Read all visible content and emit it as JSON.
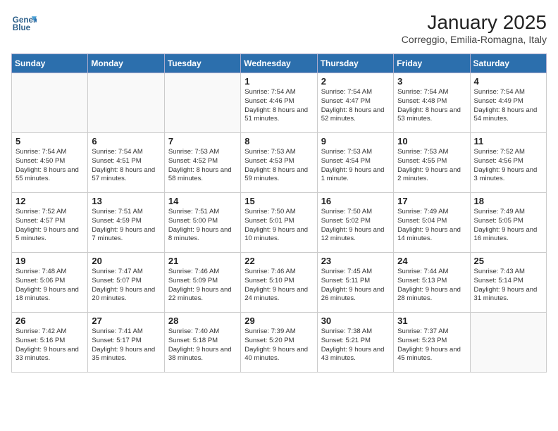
{
  "header": {
    "logo_line1": "General",
    "logo_line2": "Blue",
    "month_title": "January 2025",
    "location": "Correggio, Emilia-Romagna, Italy"
  },
  "weekdays": [
    "Sunday",
    "Monday",
    "Tuesday",
    "Wednesday",
    "Thursday",
    "Friday",
    "Saturday"
  ],
  "weeks": [
    [
      {
        "day": "",
        "sunrise": "",
        "sunset": "",
        "daylight": "",
        "empty": true
      },
      {
        "day": "",
        "sunrise": "",
        "sunset": "",
        "daylight": "",
        "empty": true
      },
      {
        "day": "",
        "sunrise": "",
        "sunset": "",
        "daylight": "",
        "empty": true
      },
      {
        "day": "1",
        "sunrise": "Sunrise: 7:54 AM",
        "sunset": "Sunset: 4:46 PM",
        "daylight": "Daylight: 8 hours and 51 minutes."
      },
      {
        "day": "2",
        "sunrise": "Sunrise: 7:54 AM",
        "sunset": "Sunset: 4:47 PM",
        "daylight": "Daylight: 8 hours and 52 minutes."
      },
      {
        "day": "3",
        "sunrise": "Sunrise: 7:54 AM",
        "sunset": "Sunset: 4:48 PM",
        "daylight": "Daylight: 8 hours and 53 minutes."
      },
      {
        "day": "4",
        "sunrise": "Sunrise: 7:54 AM",
        "sunset": "Sunset: 4:49 PM",
        "daylight": "Daylight: 8 hours and 54 minutes."
      }
    ],
    [
      {
        "day": "5",
        "sunrise": "Sunrise: 7:54 AM",
        "sunset": "Sunset: 4:50 PM",
        "daylight": "Daylight: 8 hours and 55 minutes."
      },
      {
        "day": "6",
        "sunrise": "Sunrise: 7:54 AM",
        "sunset": "Sunset: 4:51 PM",
        "daylight": "Daylight: 8 hours and 57 minutes."
      },
      {
        "day": "7",
        "sunrise": "Sunrise: 7:53 AM",
        "sunset": "Sunset: 4:52 PM",
        "daylight": "Daylight: 8 hours and 58 minutes."
      },
      {
        "day": "8",
        "sunrise": "Sunrise: 7:53 AM",
        "sunset": "Sunset: 4:53 PM",
        "daylight": "Daylight: 8 hours and 59 minutes."
      },
      {
        "day": "9",
        "sunrise": "Sunrise: 7:53 AM",
        "sunset": "Sunset: 4:54 PM",
        "daylight": "Daylight: 9 hours and 1 minute."
      },
      {
        "day": "10",
        "sunrise": "Sunrise: 7:53 AM",
        "sunset": "Sunset: 4:55 PM",
        "daylight": "Daylight: 9 hours and 2 minutes."
      },
      {
        "day": "11",
        "sunrise": "Sunrise: 7:52 AM",
        "sunset": "Sunset: 4:56 PM",
        "daylight": "Daylight: 9 hours and 3 minutes."
      }
    ],
    [
      {
        "day": "12",
        "sunrise": "Sunrise: 7:52 AM",
        "sunset": "Sunset: 4:57 PM",
        "daylight": "Daylight: 9 hours and 5 minutes."
      },
      {
        "day": "13",
        "sunrise": "Sunrise: 7:51 AM",
        "sunset": "Sunset: 4:59 PM",
        "daylight": "Daylight: 9 hours and 7 minutes."
      },
      {
        "day": "14",
        "sunrise": "Sunrise: 7:51 AM",
        "sunset": "Sunset: 5:00 PM",
        "daylight": "Daylight: 9 hours and 8 minutes."
      },
      {
        "day": "15",
        "sunrise": "Sunrise: 7:50 AM",
        "sunset": "Sunset: 5:01 PM",
        "daylight": "Daylight: 9 hours and 10 minutes."
      },
      {
        "day": "16",
        "sunrise": "Sunrise: 7:50 AM",
        "sunset": "Sunset: 5:02 PM",
        "daylight": "Daylight: 9 hours and 12 minutes."
      },
      {
        "day": "17",
        "sunrise": "Sunrise: 7:49 AM",
        "sunset": "Sunset: 5:04 PM",
        "daylight": "Daylight: 9 hours and 14 minutes."
      },
      {
        "day": "18",
        "sunrise": "Sunrise: 7:49 AM",
        "sunset": "Sunset: 5:05 PM",
        "daylight": "Daylight: 9 hours and 16 minutes."
      }
    ],
    [
      {
        "day": "19",
        "sunrise": "Sunrise: 7:48 AM",
        "sunset": "Sunset: 5:06 PM",
        "daylight": "Daylight: 9 hours and 18 minutes."
      },
      {
        "day": "20",
        "sunrise": "Sunrise: 7:47 AM",
        "sunset": "Sunset: 5:07 PM",
        "daylight": "Daylight: 9 hours and 20 minutes."
      },
      {
        "day": "21",
        "sunrise": "Sunrise: 7:46 AM",
        "sunset": "Sunset: 5:09 PM",
        "daylight": "Daylight: 9 hours and 22 minutes."
      },
      {
        "day": "22",
        "sunrise": "Sunrise: 7:46 AM",
        "sunset": "Sunset: 5:10 PM",
        "daylight": "Daylight: 9 hours and 24 minutes."
      },
      {
        "day": "23",
        "sunrise": "Sunrise: 7:45 AM",
        "sunset": "Sunset: 5:11 PM",
        "daylight": "Daylight: 9 hours and 26 minutes."
      },
      {
        "day": "24",
        "sunrise": "Sunrise: 7:44 AM",
        "sunset": "Sunset: 5:13 PM",
        "daylight": "Daylight: 9 hours and 28 minutes."
      },
      {
        "day": "25",
        "sunrise": "Sunrise: 7:43 AM",
        "sunset": "Sunset: 5:14 PM",
        "daylight": "Daylight: 9 hours and 31 minutes."
      }
    ],
    [
      {
        "day": "26",
        "sunrise": "Sunrise: 7:42 AM",
        "sunset": "Sunset: 5:16 PM",
        "daylight": "Daylight: 9 hours and 33 minutes."
      },
      {
        "day": "27",
        "sunrise": "Sunrise: 7:41 AM",
        "sunset": "Sunset: 5:17 PM",
        "daylight": "Daylight: 9 hours and 35 minutes."
      },
      {
        "day": "28",
        "sunrise": "Sunrise: 7:40 AM",
        "sunset": "Sunset: 5:18 PM",
        "daylight": "Daylight: 9 hours and 38 minutes."
      },
      {
        "day": "29",
        "sunrise": "Sunrise: 7:39 AM",
        "sunset": "Sunset: 5:20 PM",
        "daylight": "Daylight: 9 hours and 40 minutes."
      },
      {
        "day": "30",
        "sunrise": "Sunrise: 7:38 AM",
        "sunset": "Sunset: 5:21 PM",
        "daylight": "Daylight: 9 hours and 43 minutes."
      },
      {
        "day": "31",
        "sunrise": "Sunrise: 7:37 AM",
        "sunset": "Sunset: 5:23 PM",
        "daylight": "Daylight: 9 hours and 45 minutes."
      },
      {
        "day": "",
        "sunrise": "",
        "sunset": "",
        "daylight": "",
        "empty": true
      }
    ]
  ]
}
